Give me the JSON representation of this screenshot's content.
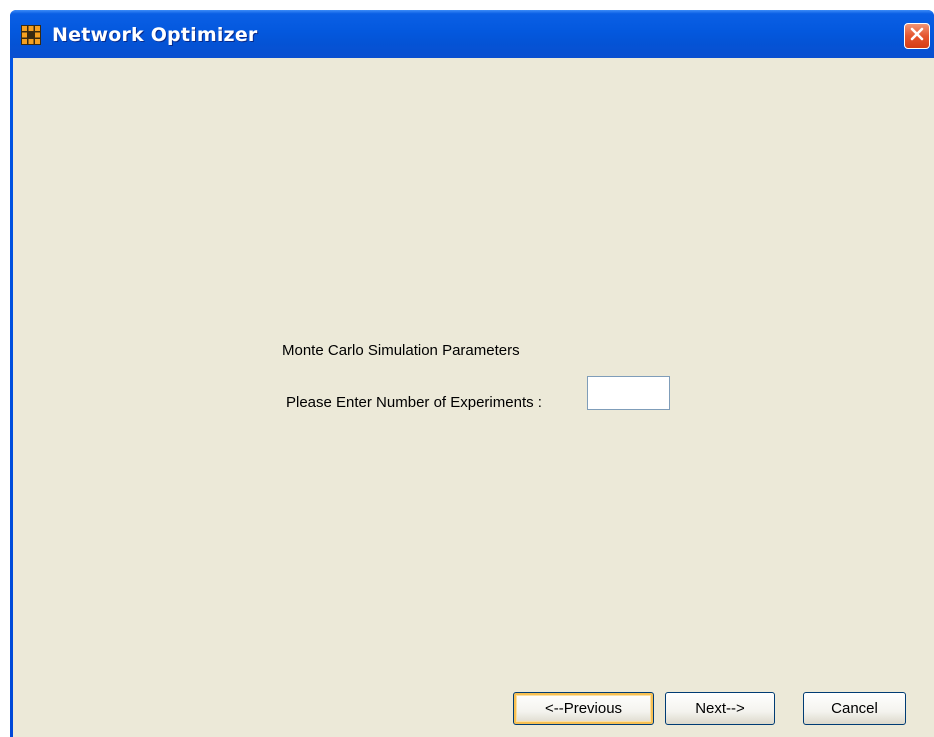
{
  "window": {
    "title": "Network Optimizer",
    "app_icon": "network-grid-icon",
    "close_icon": "close-icon"
  },
  "colors": {
    "titlebar": "#0458de",
    "client_background": "#ece9d8",
    "close_button": "#e5562f",
    "app_icon_orange": "#f5a020",
    "app_icon_dark": "#3a2a10"
  },
  "main": {
    "section_label": "Monte Carlo Simulation Parameters",
    "experiments_label": "Please Enter Number of Experiments :",
    "experiments_value": ""
  },
  "buttons": {
    "previous_label": "<--Previous",
    "next_label": "Next-->",
    "cancel_label": "Cancel"
  }
}
